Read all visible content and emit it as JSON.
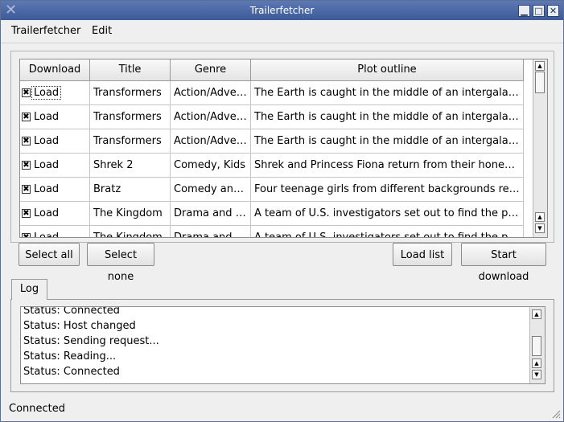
{
  "window": {
    "title": "Trailerfetcher"
  },
  "menu": {
    "items": [
      "Trailerfetcher",
      "Edit"
    ]
  },
  "table": {
    "columns": [
      "Download",
      "Title",
      "Genre",
      "Plot outline"
    ],
    "rows": [
      {
        "download": "Load",
        "checked": true,
        "title": "Transformers",
        "genre": "Action/Adventure",
        "plot": "The Earth is caught in the middle of an intergalactic war"
      },
      {
        "download": "Load",
        "checked": true,
        "title": "Transformers",
        "genre": "Action/Adventure",
        "plot": "The Earth is caught in the middle of an intergalactic war"
      },
      {
        "download": "Load",
        "checked": true,
        "title": "Transformers",
        "genre": "Action/Adventure",
        "plot": "The Earth is caught in the middle of an intergalactic war"
      },
      {
        "download": "Load",
        "checked": true,
        "title": "Shrek 2",
        "genre": "Comedy, Kids",
        "plot": "Shrek and Princess Fiona return from their honeymoon"
      },
      {
        "download": "Load",
        "checked": true,
        "title": "Bratz",
        "genre": "Comedy and Family",
        "plot": "Four teenage girls from different backgrounds rejoin"
      },
      {
        "download": "Load",
        "checked": true,
        "title": "The Kingdom",
        "genre": "Drama and Thriller",
        "plot": "A team of U.S. investigators set out to find the perpetrators"
      },
      {
        "download": "Load",
        "checked": true,
        "title": "The Kingdom",
        "genre": "Drama and Thriller",
        "plot": "A team of U.S. investigators set out to find the perpetrators"
      }
    ],
    "scroll_position": 0.0
  },
  "buttons": {
    "select_all": "Select all",
    "select_none": "Select none",
    "load_list": "Load list",
    "start_download": "Start download"
  },
  "tabs": [
    "Log"
  ],
  "log": {
    "lines": [
      "Status: Connected",
      "Status: Host changed",
      "Status: Sending request...",
      "Status: Reading...",
      "Status: Connected"
    ],
    "scroll_position": 1.0
  },
  "status": {
    "text": "Connected"
  },
  "icons": {
    "app": "x-logo-icon",
    "minimize": "minimize-icon",
    "maximize": "maximize-icon",
    "close": "close-icon",
    "checkbox": "checkbox-checked-icon",
    "scroll_up": "arrow-up-icon",
    "scroll_down": "arrow-down-icon",
    "grip": "resize-grip-icon"
  },
  "colors": {
    "titlebar": "#4a67a6",
    "window_bg": "#efefef"
  }
}
